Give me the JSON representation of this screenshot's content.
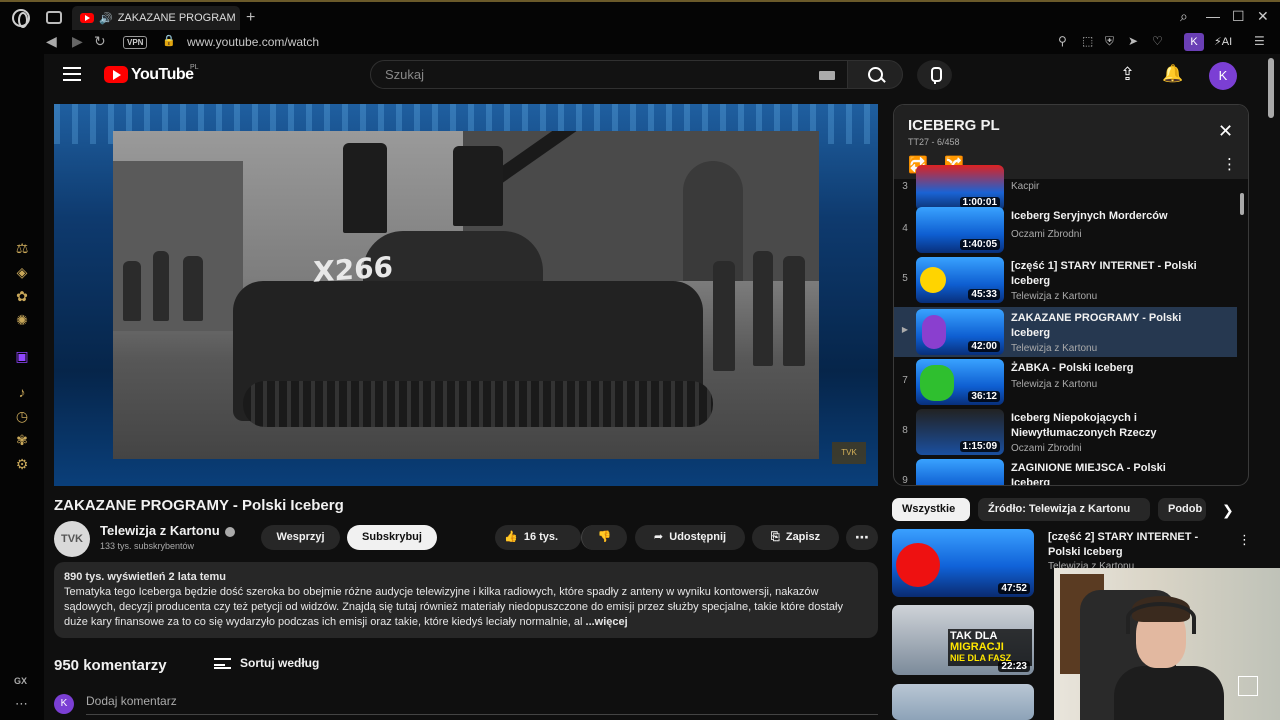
{
  "browser": {
    "tab_title": "ZAKAZANE PROGRAMY - Polski Iceberg",
    "tab_display": "ZAKAZANE PROGRAM",
    "new_tab": "+",
    "url": "www.youtube.com/watch",
    "vpn_label": "VPN",
    "profile_initial": "K",
    "ai_label": "AI",
    "sidebar_label": "GX",
    "window_controls": [
      "search-icon",
      "minimize-icon",
      "maximize-icon",
      "close-icon"
    ]
  },
  "youtube": {
    "brand": "YouTube",
    "country": "PL",
    "search_placeholder": "Szukaj",
    "avatar_initial": "K"
  },
  "video": {
    "title": "ZAKAZANE PROGRAMY - Polski Iceberg",
    "tank_marking": "X266",
    "watermark": "TVK",
    "channel": {
      "avatar_text": "TVK",
      "name": "Telewizja z Kartonu",
      "subscribers": "133 tys. subskrybentów"
    },
    "actions": {
      "support": "Wesprzyj",
      "subscribe": "Subskrybuj",
      "likes": "16 tys.",
      "share": "Udostępnij",
      "save": "Zapisz",
      "more": "⋯"
    },
    "description": {
      "meta": "890 tys. wyświetleń  2 lata temu",
      "text": "Tematyka tego Iceberga będzie dość szeroka bo obejmie różne audycje telewizyjne i kilka radiowych, które spadły z anteny w wyniku kontowersji, nakazów sądowych, decyzji producenta czy też petycji od widzów. Znajdą się tutaj również materiały niedopuszczone do emisji przez służby specjalne, takie które dostały duże kary finansowe za to co się wydarzyło podczas ich emisji oraz takie, które kiedyś leciały normalnie, al",
      "more": " ...więcej"
    },
    "comments": {
      "count": "950 komentarzy",
      "sort_label": "Sortuj według",
      "avatar": "K",
      "add_placeholder": "Dodaj komentarz"
    }
  },
  "playlist": {
    "title": "ICEBERG PL",
    "subtitle": "TT27 - 6/458",
    "items": [
      {
        "index": "3",
        "title": "",
        "channel": "Kacpir",
        "duration": "1:00:01",
        "active": false
      },
      {
        "index": "4",
        "title": "Iceberg Seryjnych Morderców",
        "channel": "Oczami Zbrodni",
        "duration": "1:40:05",
        "active": false
      },
      {
        "index": "5",
        "title": "[część 1] STARY INTERNET - Polski Iceberg",
        "channel": "Telewizja z Kartonu",
        "duration": "45:33",
        "active": false
      },
      {
        "index": "▶",
        "title": "ZAKAZANE PROGRAMY - Polski Iceberg",
        "channel": "Telewizja z Kartonu",
        "duration": "42:00",
        "active": true
      },
      {
        "index": "7",
        "title": "ŻABKA - Polski Iceberg",
        "channel": "Telewizja z Kartonu",
        "duration": "36:12",
        "active": false
      },
      {
        "index": "8",
        "title": "Iceberg Niepokojących i Niewytłumaczonych Rzeczy",
        "channel": "Oczami Zbrodni",
        "duration": "1:15:09",
        "active": false
      },
      {
        "index": "9",
        "title": "ZAGINIONE MIEJSCA - Polski Iceberg",
        "channel": "",
        "duration": "",
        "active": false
      }
    ]
  },
  "chips": [
    "Wszystkie",
    "Źródło: Telewizja z Kartonu",
    "Podob"
  ],
  "recommendations": [
    {
      "title": "[część 2] STARY INTERNET - Polski Iceberg",
      "channel": "Telewizja z Kartonu",
      "duration": "47:52"
    },
    {
      "title": "",
      "channel": "",
      "duration": "22:23",
      "thumb_text_1": "TAK DLA",
      "thumb_text_2": "MIGRACJI",
      "thumb_text_3": "NIE DLA FASZ"
    },
    {
      "title": "",
      "channel": "",
      "duration": ""
    }
  ],
  "colors": {
    "youtube_red": "#ff0000",
    "background": "#0f0f0f",
    "surface": "#272727",
    "active_playlist": "#263850",
    "avatar_purple": "#7b3fd4",
    "opera_accent": "#c9a85a",
    "twitch": "#9146ff"
  }
}
